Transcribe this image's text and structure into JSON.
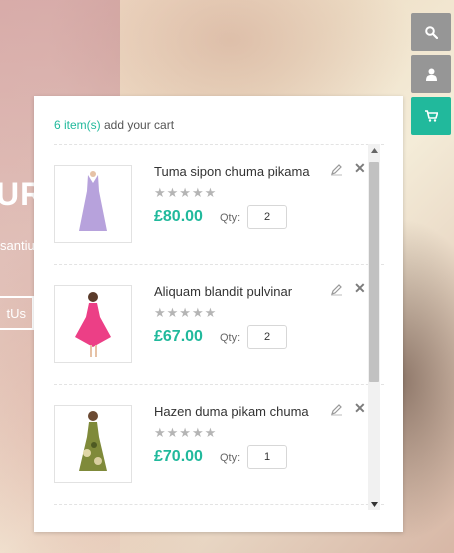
{
  "hero": {
    "title_fragment": "UR",
    "sub_fragment": "santiu",
    "button_fragment": "tUs"
  },
  "side_buttons": [
    {
      "icon": "search-icon"
    },
    {
      "icon": "user-icon"
    },
    {
      "icon": "cart-icon"
    }
  ],
  "colors": {
    "accent": "#21b99c",
    "side_gray": "#969696"
  },
  "cart": {
    "count_text": "6 item(s)",
    "header_rest": " add your cart",
    "items": [
      {
        "name": "Tuma sipon chuma pikama",
        "stars": "★★★★★",
        "price": "£80.00",
        "qty_label": "Qty:",
        "qty": "2"
      },
      {
        "name": "Aliquam blandit pulvinar",
        "stars": "★★★★★",
        "price": "£67.00",
        "qty_label": "Qty:",
        "qty": "2"
      },
      {
        "name": "Hazen duma pikam chuma",
        "stars": "★★★★★",
        "price": "£70.00",
        "qty_label": "Qty:",
        "qty": "1"
      }
    ]
  }
}
